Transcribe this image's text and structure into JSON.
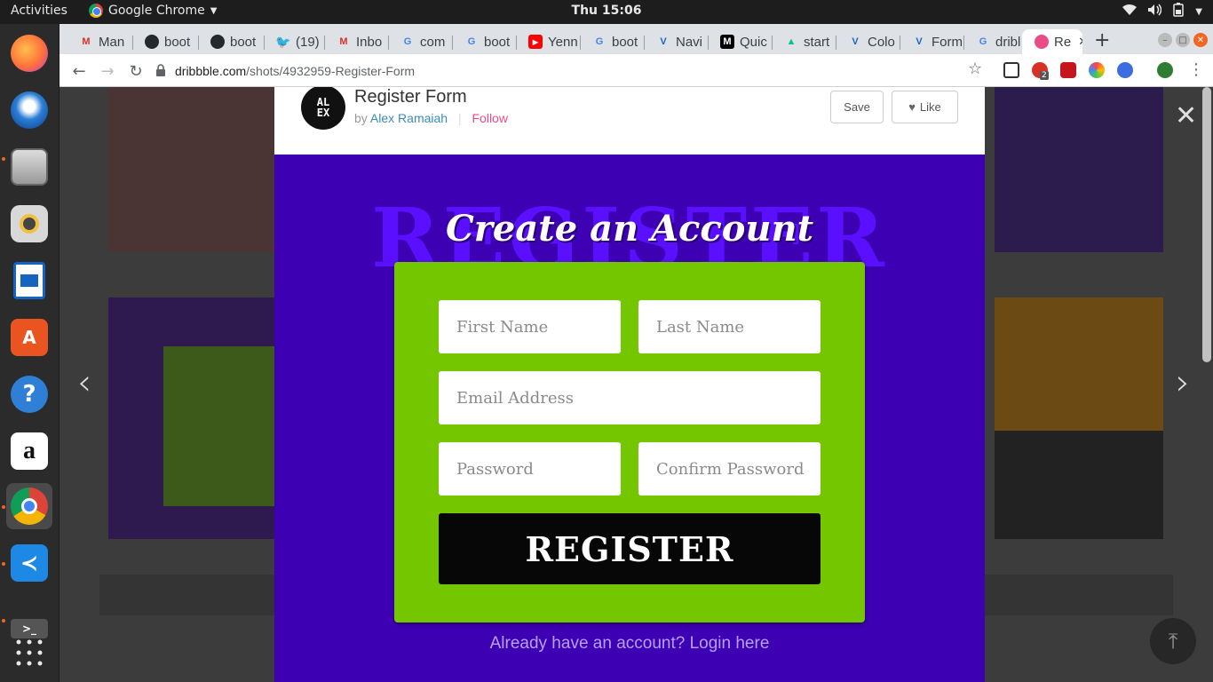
{
  "system": {
    "activities": "Activities",
    "app_name": "Google Chrome",
    "clock": "Thu 15:06"
  },
  "tabs": [
    {
      "label": "Man",
      "icon": "gmail-icon",
      "color": "#d93025"
    },
    {
      "label": "boot",
      "icon": "github-icon",
      "color": "#24292e"
    },
    {
      "label": "boot",
      "icon": "github-icon",
      "color": "#24292e"
    },
    {
      "label": "(19)",
      "icon": "twitter-icon",
      "color": "#1da1f2"
    },
    {
      "label": "Inbo",
      "icon": "gmail-icon",
      "color": "#d93025"
    },
    {
      "label": "com",
      "icon": "google-icon",
      "color": "#4285f4"
    },
    {
      "label": "boot",
      "icon": "google-icon",
      "color": "#4285f4"
    },
    {
      "label": "Yenn",
      "icon": "youtube-icon",
      "color": "#ff0000"
    },
    {
      "label": "boot",
      "icon": "google-icon",
      "color": "#4285f4"
    },
    {
      "label": "Navi",
      "icon": "vuetify-icon",
      "color": "#1867c0"
    },
    {
      "label": "Quic",
      "icon": "medium-icon",
      "color": "#000000"
    },
    {
      "label": "start",
      "icon": "nuxt-icon",
      "color": "#00c58e"
    },
    {
      "label": "Colo",
      "icon": "vuetify-icon",
      "color": "#1867c0"
    },
    {
      "label": "Form",
      "icon": "vuetify-icon",
      "color": "#1867c0"
    },
    {
      "label": "dribl",
      "icon": "google-icon",
      "color": "#4285f4"
    },
    {
      "label": "Re",
      "icon": "dribbble-icon",
      "color": "#ea4c89",
      "active": true
    }
  ],
  "address": {
    "host": "dribbble.com",
    "path": "/shots/4932959-Register-Form",
    "badge": "2"
  },
  "shot": {
    "logo_text": "AL EX",
    "title": "Register Form",
    "by": "by",
    "author": "Alex Ramaiah",
    "follow": "Follow",
    "save_label": "Save",
    "like_label": "Like"
  },
  "design": {
    "bg_word": "REGISTER",
    "headline": "Create an Account",
    "fields": {
      "first_name": "First Name",
      "last_name": "Last Name",
      "email": "Email Address",
      "password": "Password",
      "confirm_password": "Confirm Password"
    },
    "register_button": "REGISTER",
    "login_link": "Already have an account? Login here",
    "colors": {
      "background": "#3e00b3",
      "card": "#74c600",
      "button": "#070707"
    }
  }
}
